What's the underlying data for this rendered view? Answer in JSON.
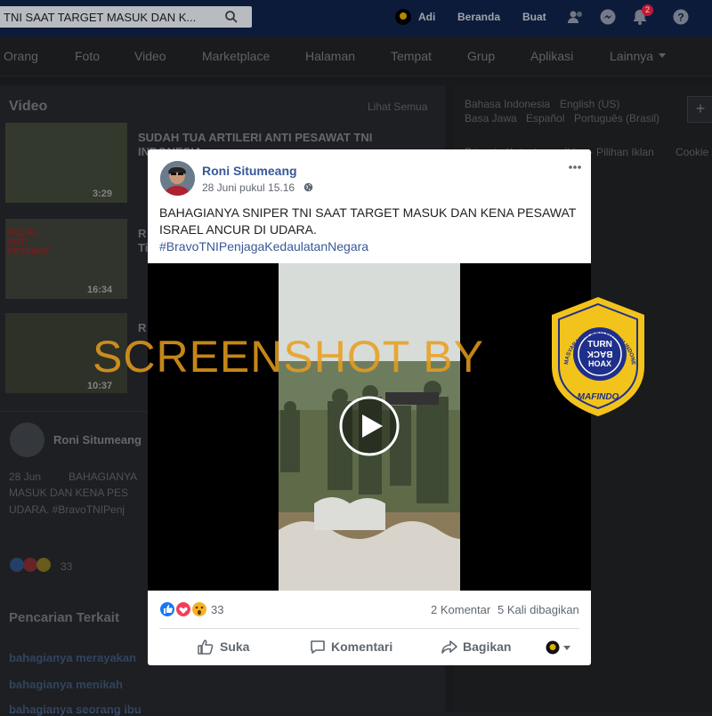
{
  "topbar": {
    "search_value": "TNI SAAT TARGET MASUK DAN K...",
    "user_name": "Adi",
    "home_label": "Beranda",
    "create_label": "Buat",
    "notification_count": "2"
  },
  "subnav": {
    "tabs": [
      "Orang",
      "Foto",
      "Video",
      "Marketplace",
      "Halaman",
      "Tempat",
      "Grup",
      "Aplikasi",
      "Lainnya"
    ]
  },
  "background": {
    "video_section_title": "Video",
    "see_all": "Lihat Semua",
    "videos": [
      {
        "title": "SUDAH TUA ARTILERI ANTI PESAWAT TNI",
        "title2": "INDONESIA",
        "duration": "3:29"
      },
      {
        "title": "R",
        "title2": "Ti",
        "duration": "16:34",
        "thumb_text": "RUDAL ANTI PESAWAT"
      },
      {
        "title": "R",
        "title2": "",
        "duration": "10:37"
      }
    ],
    "post_author": "Roni Situmeang",
    "post_date": "28 Jun",
    "post_snippet_1": "BAHAGIANYA",
    "post_snippet_2": "MASUK DAN KENA PES",
    "post_snippet_3": "UDARA. #BravoTNIPenj",
    "post_reactions": "33",
    "related_title": "Pencarian Terkait",
    "related": [
      "bahagianya merayakan",
      "bahagianya menikah",
      "bahagianya seorang ibu"
    ],
    "languages_row1": [
      "Bahasa Indonesia",
      "English (US)"
    ],
    "languages_row2": [
      "Basa Jawa",
      "Español",
      "Português (Brasil)"
    ],
    "privacy_row": "Privasi · Ketentuan · Iklan · Pilihan Iklan",
    "cookie": "Cookie"
  },
  "post": {
    "author": "Roni Situmeang",
    "timestamp": "28 Juni pukul 15.16",
    "text_line1": "BAHAGIANYA SNIPER TNI SAAT TARGET MASUK DAN KENA PESAWAT",
    "text_line2": "ISRAEL ANCUR DI UDARA.",
    "hashtag": "#BravoTNIPenjagaKedaulatanNegara",
    "reaction_count": "33",
    "comments": "2 Komentar",
    "shares": "5 Kali dibagikan",
    "like_label": "Suka",
    "comment_label": "Komentari",
    "share_label": "Bagikan"
  },
  "watermark": {
    "text": "SCREENSHOT BY",
    "logo_ring_text": "MASYARAKAT ANTI FITNAH INDONESIA",
    "logo_center_1": "TURN",
    "logo_center_2": "BACK",
    "logo_center_3": "HOAX",
    "logo_bottom": "MAFINDO"
  },
  "colors": {
    "facebook_blue": "#385898",
    "topbar": "#102046",
    "watermark": "#e89e1c",
    "logo_blue": "#1f2f8c",
    "logo_yellow": "#f2c31b"
  }
}
